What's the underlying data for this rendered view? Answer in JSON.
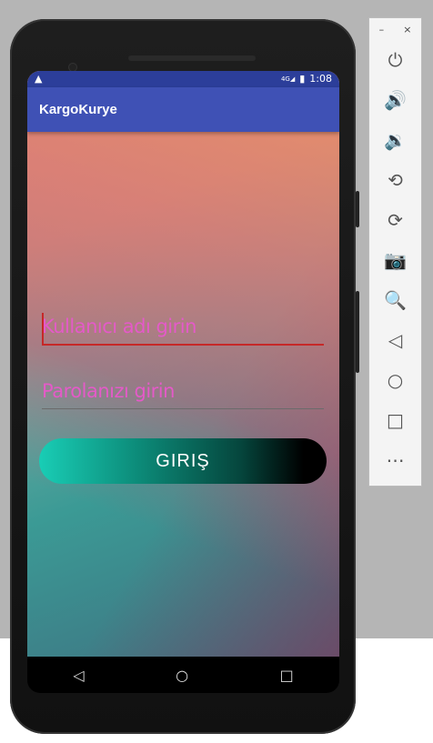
{
  "status_bar": {
    "warning_icon": "warning-icon",
    "network": "4G",
    "battery_icon": "battery-charging-icon",
    "time": "1:08"
  },
  "app_bar": {
    "title": "KargoKurye"
  },
  "login": {
    "username_placeholder": "Kullanıcı adı girin",
    "password_placeholder": "Parolanızı girin",
    "login_button": "GIRIŞ"
  },
  "nav": {
    "back": "◁",
    "home": "○",
    "recents": "□"
  },
  "emulator_panel": {
    "minimize": "–",
    "close": "×",
    "icons": [
      "power-icon",
      "volume-up-icon",
      "volume-down-icon",
      "rotate-left-icon",
      "rotate-right-icon",
      "camera-icon",
      "zoom-icon",
      "back-icon",
      "home-icon",
      "overview-icon",
      "more-icon"
    ],
    "glyphs": [
      "⏻",
      "🔊",
      "🔉",
      "⟲",
      "⟳",
      "📷",
      "🔍",
      "◁",
      "○",
      "□",
      "⋯"
    ]
  },
  "colors": {
    "app_bar": "#3f51b5",
    "status_bar": "#2c3e9a",
    "hint": "#e45ac8",
    "accent": "#c62828"
  }
}
